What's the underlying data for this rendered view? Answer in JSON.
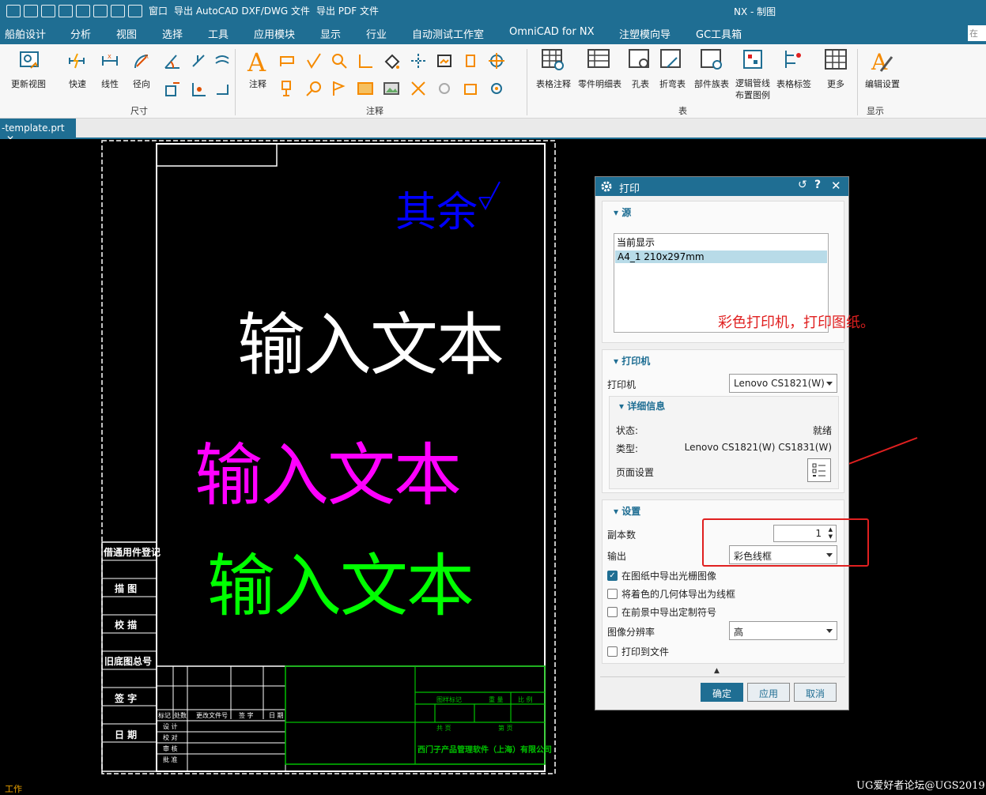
{
  "titlebar": {
    "window_menu": "窗口",
    "export_dxf": "导出 AutoCAD DXF/DWG 文件",
    "export_pdf": "导出 PDF 文件",
    "app_title": "NX - 制图"
  },
  "menu": [
    "船舶设计",
    "分析",
    "视图",
    "选择",
    "工具",
    "应用模块",
    "显示",
    "行业",
    "自动测试工作室",
    "OmniCAD for NX",
    "注塑模向导",
    "GC工具箱"
  ],
  "search_placeholder": "在此",
  "ribbon": {
    "update_views": "更新视图",
    "quick": "快速",
    "linear": "线性",
    "radial": "径向",
    "dimension_group": "尺寸",
    "note": "注释",
    "annotation_group": "注释",
    "table_note": "表格注释",
    "parts_list": "零件明细表",
    "hole_table": "孔表",
    "bend_table": "折弯表",
    "part_family_table": "部件族表",
    "logic_pipe_line1": "逻辑管线",
    "logic_pipe_line2": "布置图例",
    "table_label": "表格标签",
    "more": "更多",
    "table_group": "表",
    "edit_settings": "编辑设置",
    "display_group": "显示"
  },
  "tab": {
    "label": "-template.prt",
    "close": "✕"
  },
  "drawing": {
    "roughness_text": "其余",
    "text_white": "输入文本",
    "text_magenta": "输入文本",
    "text_green": "输入文本",
    "side_labels": [
      "借通用件登记",
      "描 图",
      "校 描",
      "旧底图总号",
      "签 字",
      "日 期"
    ],
    "title_block_cells": [
      "标记",
      "处数",
      "更改文件号",
      "签 字",
      "日 期",
      "设 计",
      "校 对",
      "审 核",
      "批 准",
      "图样标记",
      "重 量",
      "比 例",
      "共 页",
      "第 页"
    ],
    "company": "西门子产品管理软件（上海）有限公司"
  },
  "colors": {
    "accent": "#1f6e93",
    "white_text": "#ffffff",
    "magenta": "#ff00ff",
    "green": "#00ff00",
    "blue": "#0000ff",
    "annotation_red": "#e02020",
    "frame_green": "#00c000"
  },
  "dialog": {
    "title": "打印",
    "source_section": "源",
    "source_items": [
      "当前显示",
      "A4_1  210x297mm"
    ],
    "selected_source": "A4_1  210x297mm",
    "printer_section": "打印机",
    "printer_label": "打印机",
    "printer_value": "Lenovo CS1821(W)",
    "details_section": "详细信息",
    "status_label": "状态:",
    "status_value": "就绪",
    "type_label": "类型:",
    "type_value": "Lenovo CS1821(W) CS1831(W)",
    "page_setup_label": "页面设置",
    "settings_section": "设置",
    "copies_label": "副本数",
    "copies_value": "1",
    "output_label": "输出",
    "output_value": "彩色线框",
    "export_raster": "在图纸中导出光栅图像",
    "export_raster_checked": true,
    "export_colored_wire": "将着色的几何体导出为线框",
    "export_colored_wire_checked": false,
    "export_custom_symbol": "在前景中导出定制符号",
    "export_custom_symbol_checked": false,
    "resolution_label": "图像分辨率",
    "resolution_value": "高",
    "print_to_file": "打印到文件",
    "print_to_file_checked": false,
    "ok": "确定",
    "apply": "应用",
    "cancel": "取消"
  },
  "annotation_text": "彩色打印机，打印图纸。",
  "status_text": "工作",
  "watermark": "UG爱好者论坛@UGS2019"
}
